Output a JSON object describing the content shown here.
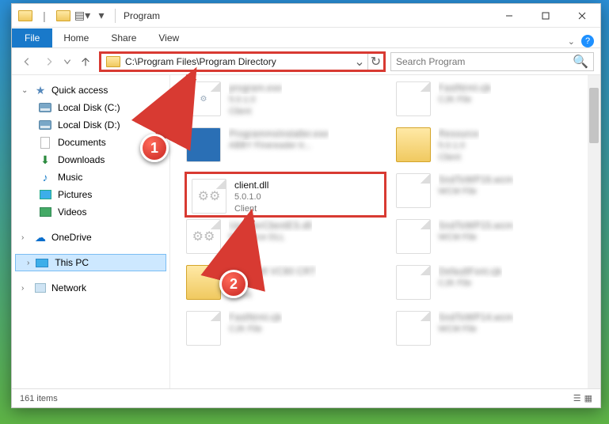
{
  "window": {
    "title": "Program"
  },
  "ribbon": {
    "file": "File",
    "tabs": [
      "Home",
      "Share",
      "View"
    ]
  },
  "address": {
    "path": "C:\\Program Files\\Program Directory",
    "search_placeholder": "Search Program"
  },
  "sidebar": {
    "quick_access": {
      "label": "Quick access",
      "items": [
        {
          "label": "Local Disk (C:)",
          "icon": "disk"
        },
        {
          "label": "Local Disk (D:)",
          "icon": "disk"
        },
        {
          "label": "Documents",
          "icon": "doc"
        },
        {
          "label": "Downloads",
          "icon": "down"
        },
        {
          "label": "Music",
          "icon": "music"
        },
        {
          "label": "Pictures",
          "icon": "pic"
        },
        {
          "label": "Videos",
          "icon": "vid"
        }
      ]
    },
    "onedrive": {
      "label": "OneDrive"
    },
    "this_pc": {
      "label": "This PC"
    },
    "network": {
      "label": "Network"
    }
  },
  "files": {
    "row0": {
      "left": {
        "name": "program.exe",
        "line2": "5.0.1.0",
        "line3": "Client",
        "kind": "exe"
      },
      "right": {
        "name": "FastNrml.cjk",
        "line2": "CJK File",
        "line3": "",
        "kind": "generic"
      }
    },
    "row1": {
      "left": {
        "name": "ProgrammsInstaller.exe",
        "line2": "ABBY Finereader tr...",
        "line3": "",
        "kind": "exe-blue"
      },
      "right": {
        "name": "Resource",
        "line2": "5.0.1.0",
        "line3": "Client",
        "kind": "folder"
      }
    },
    "row2": {
      "left": {
        "name": "client.dll",
        "line2": "5.0.1.0",
        "line3": "Client",
        "kind": "dll"
      },
      "right": {
        "name": "SndToWP16.wcm",
        "line2": "WCM File",
        "line3": "",
        "kind": "generic"
      }
    },
    "row3": {
      "left": {
        "name": "UpdaterClientES.dll",
        "line2": "Resource DLL",
        "line3": "",
        "kind": "dll"
      },
      "right": {
        "name": "SndToWP15.wcm",
        "line2": "WCM File",
        "line3": "",
        "kind": "generic"
      }
    },
    "row4": {
      "left": {
        "name": "Microsoft VC90 CRT",
        "line2": "5.0.1.0",
        "line3": "Client",
        "kind": "folder"
      },
      "right": {
        "name": "DefaultFont.cjk",
        "line2": "CJK File",
        "line3": "",
        "kind": "generic"
      }
    },
    "row5": {
      "left": {
        "name": "FastNrml.cjk",
        "line2": "CJK File",
        "line3": "",
        "kind": "generic"
      },
      "right": {
        "name": "SndToWP14.wcm",
        "line2": "WCM File",
        "line3": "",
        "kind": "generic"
      }
    }
  },
  "status": {
    "count": "161 items"
  },
  "callouts": {
    "one": "1",
    "two": "2"
  }
}
